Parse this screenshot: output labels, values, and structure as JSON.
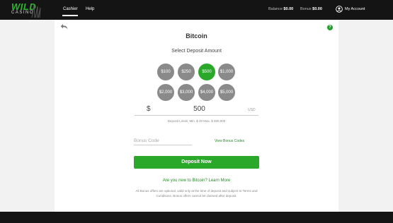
{
  "header": {
    "logo_main": "WILD",
    "logo_sub": "CASINO",
    "nav": {
      "cashier": "Cashier",
      "help": "Help"
    },
    "balance_label": "Balance",
    "balance_value": "$0.00",
    "bonus_label": "Bonus",
    "bonus_value": "$0.00",
    "account_label": "My Account"
  },
  "page": {
    "title": "Bitcoin",
    "subtitle": "Select Deposit Amount",
    "help_badge": "?",
    "amounts_row1": [
      "$100",
      "$250",
      "$500",
      "$1,000"
    ],
    "amounts_row2": [
      "$2,000",
      "$3,000",
      "$4,000",
      "$5,000"
    ],
    "selected_amount": "$500",
    "currency_symbol": "$",
    "amount_value": "500",
    "currency_code": "USD",
    "limits": "Deposit Limits: Min. $ 20 Max. $ 500,000",
    "bonus_placeholder": "Bonus Code",
    "view_bonus_codes": "View Bonus Codes",
    "deposit_button": "Deposit Now",
    "learn_more": "Are you new to Bitcoin? Learn More",
    "disclaimer": "All Bonus offers are optional, valid only at the time of deposit and subject to Terms and Conditions. Bonus offers cannot be claimed after deposit."
  },
  "colors": {
    "accent": "#2aa82a",
    "chip_default": "#8a8a8a",
    "header_bg": "#141414"
  }
}
